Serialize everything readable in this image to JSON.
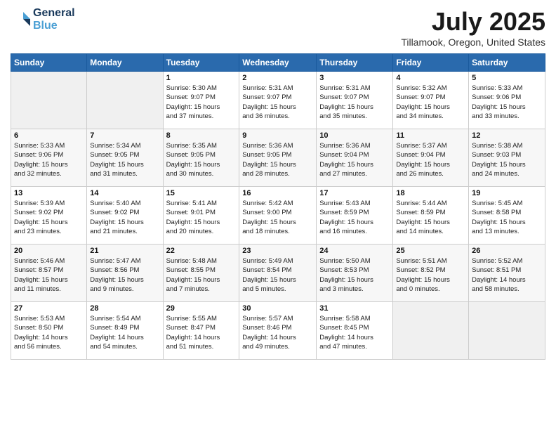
{
  "header": {
    "logo_line1": "General",
    "logo_line2": "Blue",
    "main_title": "July 2025",
    "subtitle": "Tillamook, Oregon, United States"
  },
  "calendar": {
    "days_of_week": [
      "Sunday",
      "Monday",
      "Tuesday",
      "Wednesday",
      "Thursday",
      "Friday",
      "Saturday"
    ],
    "weeks": [
      [
        {
          "day": "",
          "info": ""
        },
        {
          "day": "",
          "info": ""
        },
        {
          "day": "1",
          "info": "Sunrise: 5:30 AM\nSunset: 9:07 PM\nDaylight: 15 hours\nand 37 minutes."
        },
        {
          "day": "2",
          "info": "Sunrise: 5:31 AM\nSunset: 9:07 PM\nDaylight: 15 hours\nand 36 minutes."
        },
        {
          "day": "3",
          "info": "Sunrise: 5:31 AM\nSunset: 9:07 PM\nDaylight: 15 hours\nand 35 minutes."
        },
        {
          "day": "4",
          "info": "Sunrise: 5:32 AM\nSunset: 9:07 PM\nDaylight: 15 hours\nand 34 minutes."
        },
        {
          "day": "5",
          "info": "Sunrise: 5:33 AM\nSunset: 9:06 PM\nDaylight: 15 hours\nand 33 minutes."
        }
      ],
      [
        {
          "day": "6",
          "info": "Sunrise: 5:33 AM\nSunset: 9:06 PM\nDaylight: 15 hours\nand 32 minutes."
        },
        {
          "day": "7",
          "info": "Sunrise: 5:34 AM\nSunset: 9:05 PM\nDaylight: 15 hours\nand 31 minutes."
        },
        {
          "day": "8",
          "info": "Sunrise: 5:35 AM\nSunset: 9:05 PM\nDaylight: 15 hours\nand 30 minutes."
        },
        {
          "day": "9",
          "info": "Sunrise: 5:36 AM\nSunset: 9:05 PM\nDaylight: 15 hours\nand 28 minutes."
        },
        {
          "day": "10",
          "info": "Sunrise: 5:36 AM\nSunset: 9:04 PM\nDaylight: 15 hours\nand 27 minutes."
        },
        {
          "day": "11",
          "info": "Sunrise: 5:37 AM\nSunset: 9:04 PM\nDaylight: 15 hours\nand 26 minutes."
        },
        {
          "day": "12",
          "info": "Sunrise: 5:38 AM\nSunset: 9:03 PM\nDaylight: 15 hours\nand 24 minutes."
        }
      ],
      [
        {
          "day": "13",
          "info": "Sunrise: 5:39 AM\nSunset: 9:02 PM\nDaylight: 15 hours\nand 23 minutes."
        },
        {
          "day": "14",
          "info": "Sunrise: 5:40 AM\nSunset: 9:02 PM\nDaylight: 15 hours\nand 21 minutes."
        },
        {
          "day": "15",
          "info": "Sunrise: 5:41 AM\nSunset: 9:01 PM\nDaylight: 15 hours\nand 20 minutes."
        },
        {
          "day": "16",
          "info": "Sunrise: 5:42 AM\nSunset: 9:00 PM\nDaylight: 15 hours\nand 18 minutes."
        },
        {
          "day": "17",
          "info": "Sunrise: 5:43 AM\nSunset: 8:59 PM\nDaylight: 15 hours\nand 16 minutes."
        },
        {
          "day": "18",
          "info": "Sunrise: 5:44 AM\nSunset: 8:59 PM\nDaylight: 15 hours\nand 14 minutes."
        },
        {
          "day": "19",
          "info": "Sunrise: 5:45 AM\nSunset: 8:58 PM\nDaylight: 15 hours\nand 13 minutes."
        }
      ],
      [
        {
          "day": "20",
          "info": "Sunrise: 5:46 AM\nSunset: 8:57 PM\nDaylight: 15 hours\nand 11 minutes."
        },
        {
          "day": "21",
          "info": "Sunrise: 5:47 AM\nSunset: 8:56 PM\nDaylight: 15 hours\nand 9 minutes."
        },
        {
          "day": "22",
          "info": "Sunrise: 5:48 AM\nSunset: 8:55 PM\nDaylight: 15 hours\nand 7 minutes."
        },
        {
          "day": "23",
          "info": "Sunrise: 5:49 AM\nSunset: 8:54 PM\nDaylight: 15 hours\nand 5 minutes."
        },
        {
          "day": "24",
          "info": "Sunrise: 5:50 AM\nSunset: 8:53 PM\nDaylight: 15 hours\nand 3 minutes."
        },
        {
          "day": "25",
          "info": "Sunrise: 5:51 AM\nSunset: 8:52 PM\nDaylight: 15 hours\nand 0 minutes."
        },
        {
          "day": "26",
          "info": "Sunrise: 5:52 AM\nSunset: 8:51 PM\nDaylight: 14 hours\nand 58 minutes."
        }
      ],
      [
        {
          "day": "27",
          "info": "Sunrise: 5:53 AM\nSunset: 8:50 PM\nDaylight: 14 hours\nand 56 minutes."
        },
        {
          "day": "28",
          "info": "Sunrise: 5:54 AM\nSunset: 8:49 PM\nDaylight: 14 hours\nand 54 minutes."
        },
        {
          "day": "29",
          "info": "Sunrise: 5:55 AM\nSunset: 8:47 PM\nDaylight: 14 hours\nand 51 minutes."
        },
        {
          "day": "30",
          "info": "Sunrise: 5:57 AM\nSunset: 8:46 PM\nDaylight: 14 hours\nand 49 minutes."
        },
        {
          "day": "31",
          "info": "Sunrise: 5:58 AM\nSunset: 8:45 PM\nDaylight: 14 hours\nand 47 minutes."
        },
        {
          "day": "",
          "info": ""
        },
        {
          "day": "",
          "info": ""
        }
      ]
    ]
  }
}
